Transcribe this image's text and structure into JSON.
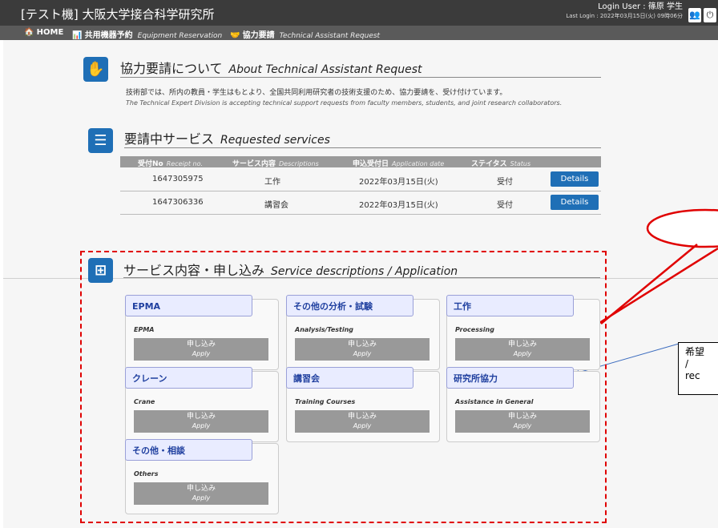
{
  "header": {
    "title": "[テスト機] 大阪大学接合科学研究所",
    "login_user": "Login User : 篠原 学生",
    "last_login": "Last Login : 2022年03月15日(火) 09時06分"
  },
  "nav": {
    "home": "HOME",
    "equipment_jp": "共用機器予約",
    "equipment_en": "Equipment Reservation",
    "assist_jp": "協力要請",
    "assist_en": "Technical Assistant Request"
  },
  "about": {
    "title_jp": "協力要請について",
    "title_en": "About Technical Assistant Request",
    "desc_jp": "技術部では、所内の教員・学生はもとより、全国共同利用研究者の技術支援のため、協力要請を、受け付けています。",
    "desc_en": "The Technical Expert Division is accepting technical support requests from faculty members, students, and joint research collaborators."
  },
  "requested": {
    "title_jp": "要請中サービス",
    "title_en": "Requested services",
    "columns": [
      {
        "jp": "受付No",
        "en": "Receipt no."
      },
      {
        "jp": "サービス内容",
        "en": "Descriptions"
      },
      {
        "jp": "申込受付日",
        "en": "Application date"
      },
      {
        "jp": "ステイタス",
        "en": "Status"
      }
    ],
    "rows": [
      {
        "receipt": "1647305975",
        "service": "工作",
        "date": "2022年03月15日(火)",
        "status": "受付",
        "action": "Details"
      },
      {
        "receipt": "1647306336",
        "service": "講習会",
        "date": "2022年03月15日(火)",
        "status": "受付",
        "action": "Details"
      }
    ]
  },
  "services": {
    "title_jp": "サービス内容・申し込み",
    "title_en": "Service descriptions / Application",
    "apply_jp": "申し込み",
    "apply_en": "Apply",
    "cards": [
      {
        "name": "EPMA",
        "sub": "EPMA"
      },
      {
        "name": "その他の分析・試験",
        "sub": "Analysis/Testing"
      },
      {
        "name": "工作",
        "sub": "Processing"
      },
      {
        "name": "クレーン",
        "sub": "Crane"
      },
      {
        "name": "講習会",
        "sub": "Training Courses"
      },
      {
        "name": "研究所協力",
        "sub": "Assistance in General"
      },
      {
        "name": "その他・相談",
        "sub": "Others"
      }
    ]
  },
  "annotation": {
    "line1": "希望",
    "line2": "/",
    "line3": "rec"
  },
  "colors": {
    "accent": "#1f6fb6",
    "annotation": "#e00000"
  }
}
